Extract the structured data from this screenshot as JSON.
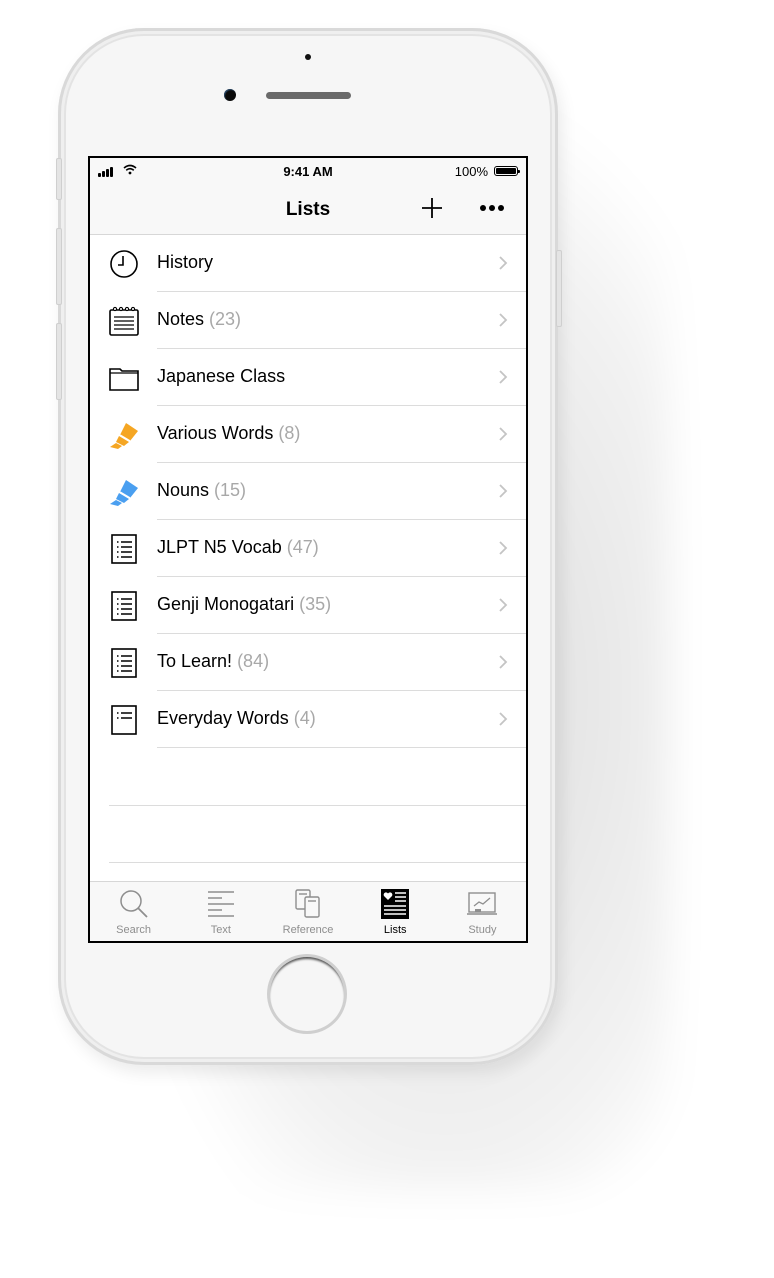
{
  "status_bar": {
    "time": "9:41 AM",
    "battery_percent": "100%",
    "signal_bars": 4,
    "wifi": true
  },
  "nav_bar": {
    "title": "Lists",
    "add_icon": "plus-icon",
    "more_icon": "ellipsis-icon"
  },
  "lists": [
    {
      "label": "History",
      "count": "",
      "icon": "clock-icon"
    },
    {
      "label": "Notes",
      "count": "(23)",
      "icon": "notepad-icon"
    },
    {
      "label": "Japanese Class",
      "count": "",
      "icon": "folder-icon"
    },
    {
      "label": "Various Words",
      "count": "(8)",
      "icon": "highlighter-icon",
      "color": "#f5a623"
    },
    {
      "label": "Nouns",
      "count": "(15)",
      "icon": "highlighter-icon",
      "color": "#4a9ff0"
    },
    {
      "label": "JLPT N5 Vocab",
      "count": "(47)",
      "icon": "list-icon"
    },
    {
      "label": "Genji Monogatari",
      "count": "(35)",
      "icon": "list-icon"
    },
    {
      "label": "To Learn!",
      "count": "(84)",
      "icon": "list-icon"
    },
    {
      "label": "Everyday Words",
      "count": "(4)",
      "icon": "short-list-icon"
    }
  ],
  "tab_bar": {
    "active": "Lists",
    "tabs": [
      {
        "label": "Search",
        "icon": "magnifier-icon"
      },
      {
        "label": "Text",
        "icon": "text-lines-icon"
      },
      {
        "label": "Reference",
        "icon": "books-icon"
      },
      {
        "label": "Lists",
        "icon": "heart-list-icon"
      },
      {
        "label": "Study",
        "icon": "chart-board-icon"
      }
    ]
  },
  "colors": {
    "accent_text": "#000000",
    "count_text": "#a8a8a8",
    "inactive_tab": "#8e8e8e",
    "highlighter_orange": "#f5a623",
    "highlighter_blue": "#4a9ff0"
  }
}
